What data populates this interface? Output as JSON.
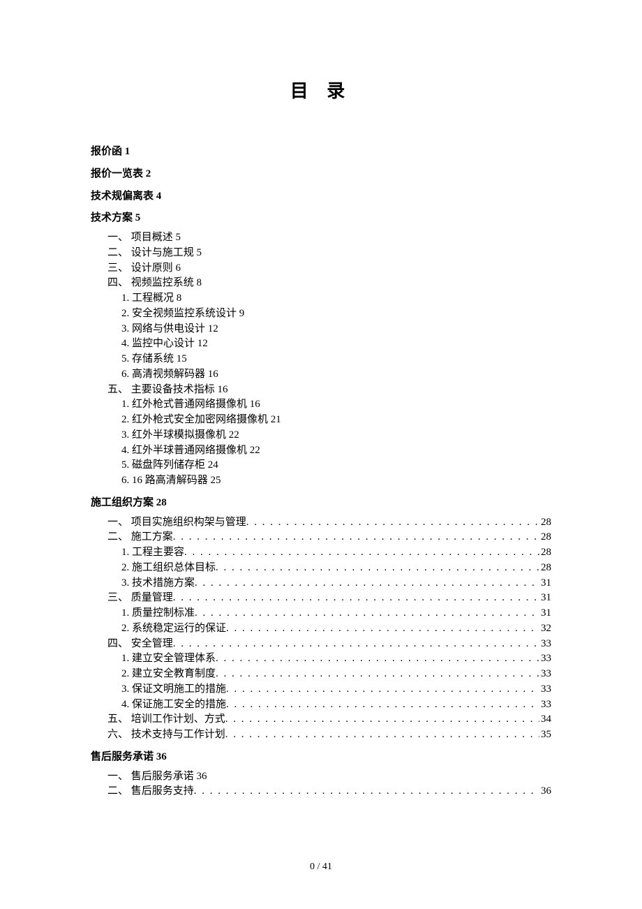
{
  "title": "目 录",
  "footer": "0 / 41",
  "entries": [
    {
      "indent": 0,
      "bold": true,
      "label": "报价函 1",
      "page": null,
      "leaders": false
    },
    {
      "indent": 0,
      "bold": true,
      "label": "报价一览表 2",
      "page": null,
      "leaders": false
    },
    {
      "indent": 0,
      "bold": true,
      "label": "技术规偏离表 4",
      "page": null,
      "leaders": false
    },
    {
      "indent": 0,
      "bold": true,
      "label": "技术方案 5",
      "page": null,
      "leaders": false
    },
    {
      "indent": 1,
      "bold": false,
      "label": "一、 项目概述 5",
      "page": null,
      "leaders": false
    },
    {
      "indent": 1,
      "bold": false,
      "label": "二、 设计与施工规 5",
      "page": null,
      "leaders": false
    },
    {
      "indent": 1,
      "bold": false,
      "label": "三、 设计原则 6",
      "page": null,
      "leaders": false
    },
    {
      "indent": 1,
      "bold": false,
      "label": "四、 视频监控系统 8",
      "page": null,
      "leaders": false
    },
    {
      "indent": 2,
      "bold": false,
      "label": "1.  工程概况 8",
      "page": null,
      "leaders": false
    },
    {
      "indent": 2,
      "bold": false,
      "label": "2.  安全视频监控系统设计 9",
      "page": null,
      "leaders": false
    },
    {
      "indent": 2,
      "bold": false,
      "label": "3.  网络与供电设计 12",
      "page": null,
      "leaders": false
    },
    {
      "indent": 2,
      "bold": false,
      "label": "4.  监控中心设计 12",
      "page": null,
      "leaders": false
    },
    {
      "indent": 2,
      "bold": false,
      "label": "5.  存储系统 15",
      "page": null,
      "leaders": false
    },
    {
      "indent": 2,
      "bold": false,
      "label": "6.  高清视频解码器 16",
      "page": null,
      "leaders": false
    },
    {
      "indent": 1,
      "bold": false,
      "label": "五、 主要设备技术指标 16",
      "page": null,
      "leaders": false
    },
    {
      "indent": 2,
      "bold": false,
      "label": "1.  红外枪式普通网络摄像机 16",
      "page": null,
      "leaders": false
    },
    {
      "indent": 2,
      "bold": false,
      "label": "2.  红外枪式安全加密网络摄像机 21",
      "page": null,
      "leaders": false
    },
    {
      "indent": 2,
      "bold": false,
      "label": "3.  红外半球模拟摄像机 22",
      "page": null,
      "leaders": false
    },
    {
      "indent": 2,
      "bold": false,
      "label": "4.  红外半球普通网络摄像机 22",
      "page": null,
      "leaders": false
    },
    {
      "indent": 2,
      "bold": false,
      "label": "5.  磁盘阵列储存柜 24",
      "page": null,
      "leaders": false
    },
    {
      "indent": 2,
      "bold": false,
      "label": "6.  16 路高清解码器 25",
      "page": null,
      "leaders": false
    },
    {
      "indent": 0,
      "bold": true,
      "label": "施工组织方案 28",
      "page": null,
      "leaders": false
    },
    {
      "indent": 1,
      "bold": false,
      "label": "一、 项目实施组织构架与管理 ",
      "page": "28",
      "leaders": true
    },
    {
      "indent": 1,
      "bold": false,
      "label": "二、 施工方案 ",
      "page": "28",
      "leaders": true
    },
    {
      "indent": 2,
      "bold": false,
      "label": "1.  工程主要容 ",
      "page": "28",
      "leaders": true
    },
    {
      "indent": 2,
      "bold": false,
      "label": "2.  施工组织总体目标 ",
      "page": "28",
      "leaders": true
    },
    {
      "indent": 2,
      "bold": false,
      "label": "3.  技术措施方案 ",
      "page": "31",
      "leaders": true
    },
    {
      "indent": 1,
      "bold": false,
      "label": "三、 质量管理 ",
      "page": "31",
      "leaders": true
    },
    {
      "indent": 2,
      "bold": false,
      "label": "1.  质量控制标准 ",
      "page": "31",
      "leaders": true
    },
    {
      "indent": 2,
      "bold": false,
      "label": "2.  系统稳定运行的保证 ",
      "page": "32",
      "leaders": true
    },
    {
      "indent": 1,
      "bold": false,
      "label": "四、 安全管理 ",
      "page": "33",
      "leaders": true
    },
    {
      "indent": 2,
      "bold": false,
      "label": "1.  建立安全管理体系 ",
      "page": "33",
      "leaders": true
    },
    {
      "indent": 2,
      "bold": false,
      "label": "2.  建立安全教育制度 ",
      "page": "33",
      "leaders": true
    },
    {
      "indent": 2,
      "bold": false,
      "label": "3.  保证文明施工的措施 ",
      "page": "33",
      "leaders": true
    },
    {
      "indent": 2,
      "bold": false,
      "label": "4.  保证施工安全的措施 ",
      "page": "33",
      "leaders": true
    },
    {
      "indent": 1,
      "bold": false,
      "label": "五、 培训工作计划、方式 ",
      "page": "34",
      "leaders": true
    },
    {
      "indent": 1,
      "bold": false,
      "label": "六、 技术支持与工作计划 ",
      "page": "35",
      "leaders": true
    },
    {
      "indent": 0,
      "bold": true,
      "label": "售后服务承诺 36",
      "page": null,
      "leaders": false
    },
    {
      "indent": 1,
      "bold": false,
      "label": "一、 售后服务承诺 36",
      "page": null,
      "leaders": false
    },
    {
      "indent": 1,
      "bold": false,
      "label": "二、 售后服务支持 ",
      "page": "36",
      "leaders": true
    }
  ]
}
